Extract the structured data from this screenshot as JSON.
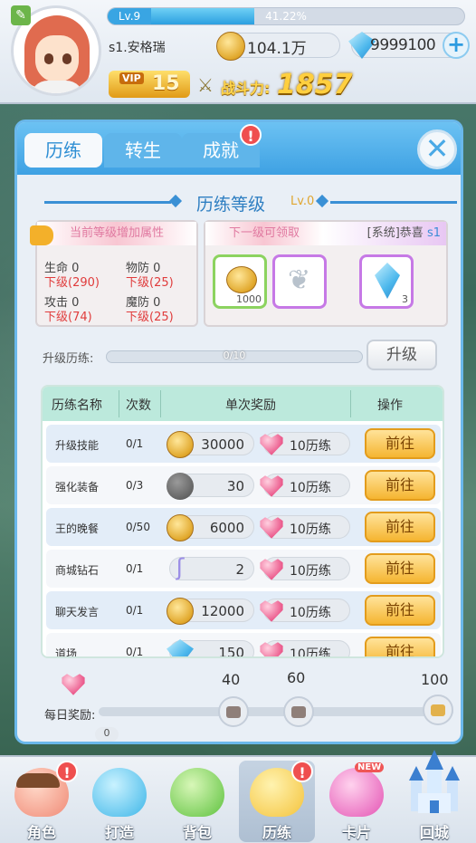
{
  "header": {
    "level_label": "Lv.9",
    "exp_percent_text": "41.22%",
    "exp_fraction": 0.4122,
    "player_name": "s1.安格瑞",
    "gold": "104.1万",
    "diamonds": "9999100",
    "vip_label": "VIP",
    "vip_level": "15",
    "power_label": "战斗力:",
    "power_value": "1857"
  },
  "tabs": [
    {
      "label": "历练"
    },
    {
      "label": "转生"
    },
    {
      "label": "成就"
    }
  ],
  "badge_mark": "!",
  "section": {
    "title": "历练等级",
    "level": "Lv.0"
  },
  "current_box": {
    "caption": "当前等级增加属性",
    "stats": [
      {
        "name": "生命",
        "value": "0",
        "next": "下级(290)"
      },
      {
        "name": "物防",
        "value": "0",
        "next": "下级(25)"
      },
      {
        "name": "攻击",
        "value": "0",
        "next": "下级(74)"
      },
      {
        "name": "魔防",
        "value": "0",
        "next": "下级(25)"
      }
    ]
  },
  "next_box": {
    "caption": "下一级可领取",
    "system_msg": "[系统]恭喜",
    "system_suffix": "s1",
    "items": [
      {
        "count": "1000",
        "icon": "gold-coin"
      },
      {
        "count": "",
        "icon": "feather"
      },
      {
        "count": "3",
        "icon": "crystal"
      }
    ]
  },
  "upgrade": {
    "label": "升级历练:",
    "progress_text": "0/10",
    "progress": 0,
    "button": "升级"
  },
  "table": {
    "columns": [
      "历练名称",
      "次数",
      "单次奖励",
      "操作"
    ],
    "rows": [
      {
        "name": "升级技能",
        "count": "0/1",
        "reward_amount": "30000",
        "reward_icon": "gold-coin",
        "exp": "10历练",
        "action": "前往"
      },
      {
        "name": "强化装备",
        "count": "0/3",
        "reward_amount": "30",
        "reward_icon": "dark-stone",
        "exp": "10历练",
        "action": "前往"
      },
      {
        "name": "王的晚餐",
        "count": "0/50",
        "reward_amount": "6000",
        "reward_icon": "gold-coin",
        "exp": "10历练",
        "action": "前往"
      },
      {
        "name": "商城钻石",
        "count": "0/1",
        "reward_amount": "2",
        "reward_icon": "hook",
        "exp": "10历练",
        "action": "前往"
      },
      {
        "name": "聊天发言",
        "count": "0/1",
        "reward_amount": "12000",
        "reward_icon": "gold-coin",
        "exp": "10历练",
        "action": "前往"
      },
      {
        "name": "道场",
        "count": "0/1",
        "reward_amount": "150",
        "reward_icon": "diamond",
        "exp": "10历练",
        "action": "前往"
      }
    ]
  },
  "daily": {
    "label": "每日奖励:",
    "value": "0",
    "milestones": [
      "40",
      "60",
      "100"
    ]
  },
  "nav": [
    {
      "label": "角色",
      "badge": "!"
    },
    {
      "label": "打造"
    },
    {
      "label": "背包"
    },
    {
      "label": "历练",
      "badge": "!"
    },
    {
      "label": "卡片",
      "tag": "NEW"
    },
    {
      "label": "回城"
    }
  ]
}
